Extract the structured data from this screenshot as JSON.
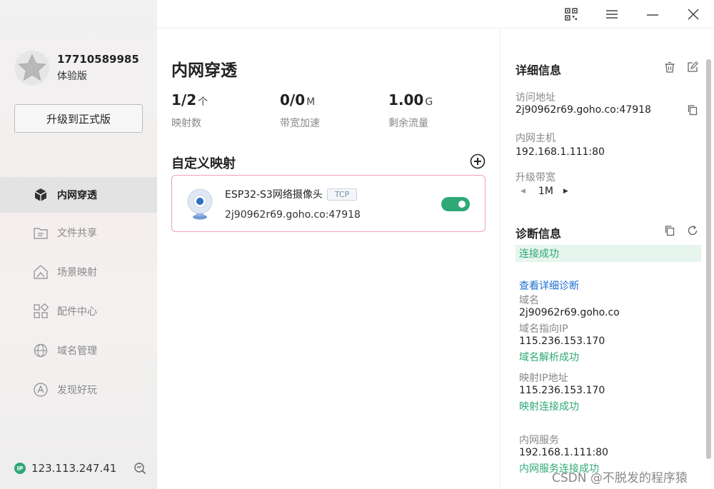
{
  "sidebar": {
    "phone": "17710589985",
    "edition": "体验版",
    "upgrade_label": "升级到正式版",
    "items": [
      {
        "label": "内网穿透",
        "icon": "cube-icon"
      },
      {
        "label": "文件共享",
        "icon": "folder-icon"
      },
      {
        "label": "场景映射",
        "icon": "scene-icon"
      },
      {
        "label": "配件中心",
        "icon": "apps-grid-icon"
      },
      {
        "label": "域名管理",
        "icon": "domain-icon"
      },
      {
        "label": "发现好玩",
        "icon": "discover-icon"
      }
    ],
    "footer": {
      "ip_badge": "IP",
      "ip": "123.113.247.41"
    }
  },
  "titlebar": {
    "icons": [
      "qr-code-icon",
      "menu-icon",
      "minimize-icon",
      "close-icon"
    ]
  },
  "main": {
    "title": "内网穿透",
    "stats": [
      {
        "value": "1/2",
        "unit": "个",
        "label": "映射数"
      },
      {
        "value": "0/0",
        "unit": "M",
        "label": "带宽加速"
      },
      {
        "value": "1.00",
        "unit": "G",
        "label": "剩余流量"
      }
    ],
    "section_title": "自定义映射",
    "mapping": {
      "name": "ESP32-S3网络摄像头",
      "protocol": "TCP",
      "address": "2j90962r69.goho.co:47918",
      "enabled": true
    }
  },
  "detail": {
    "title": "详细信息",
    "access_label": "访问地址",
    "access_value": "2j90962r69.goho.co:47918",
    "host_label": "内网主机",
    "host_value": "192.168.1.111:80",
    "bandwidth_label": "升级带宽",
    "bandwidth_value": "1M"
  },
  "diagnosis": {
    "title": "诊断信息",
    "status": "连接成功",
    "detail_link": "查看详细诊断",
    "domain_label": "域名",
    "domain_value": "2j90962r69.goho.co",
    "domain_ip_label": "域名指向IP",
    "domain_ip_value": "115.236.153.170",
    "domain_ip_status": "域名解析成功",
    "mapped_ip_label": "映射IP地址",
    "mapped_ip_value": "115.236.153.170",
    "mapped_ip_status": "映射连接成功",
    "service_label": "内网服务",
    "service_value": "192.168.1.111:80",
    "service_status": "内网服务连接成功"
  },
  "watermark": "CSDN @不脱发的程序猿",
  "colors": {
    "accent_green": "#2fa877",
    "link_blue": "#1e6fd0",
    "card_border": "#f3a0b8"
  }
}
